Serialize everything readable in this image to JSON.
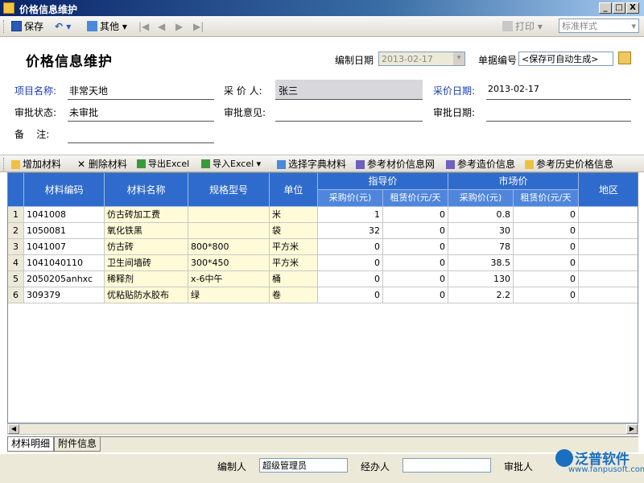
{
  "window": {
    "title": "价格信息维护",
    "controls": [
      "_",
      "□",
      "X"
    ]
  },
  "toolbar": {
    "save_label": "保存",
    "undo_label": "↶",
    "other_label": "其他",
    "nav": [
      "|◀",
      "◀",
      "▶",
      "▶|"
    ],
    "print_label": "打印",
    "style_value": "标准样式"
  },
  "header": {
    "page_title": "价格信息维护",
    "compile_date_label": "编制日期",
    "compile_date_value": "2013-02-17",
    "doc_no_label": "单据编号",
    "doc_no_value": "<保存可自动生成>",
    "project_label": "项目名称:",
    "project_value": "非常天地",
    "buyer_label": "采 价 人:",
    "buyer_value": "张三",
    "price_date_label": "采价日期:",
    "price_date_value": "2013-02-17",
    "approval_status_label": "审批状态:",
    "approval_status_value": "未审批",
    "approval_opinion_label": "审批意见:",
    "approval_date_label": "审批日期:",
    "remark_label": "备    注:"
  },
  "material_toolbar": {
    "add": "增加材料",
    "delete": "删除材料",
    "export": "导出Excel",
    "import": "导入Excel",
    "select_dict": "选择字典材料",
    "ref_material_net": "参考材价信息网",
    "ref_cost": "参考造价信息",
    "ref_history": "参考历史价格信息"
  },
  "grid": {
    "columns": [
      "材料编码",
      "材料名称",
      "规格型号",
      "单位"
    ],
    "group_guide": "指导价",
    "group_market": "市场价",
    "sub_purchase": "采购价(元)",
    "sub_rent": "租赁价(元/天",
    "region": "地区",
    "rows": [
      {
        "no": "1",
        "code": "1041008",
        "name": "仿古砖加工费",
        "spec": "",
        "unit": "米",
        "g_buy": "1",
        "g_rent": "0",
        "m_buy": "0.8",
        "m_rent": "0"
      },
      {
        "no": "2",
        "code": "1050081",
        "name": "氧化铁黑",
        "spec": "",
        "unit": "袋",
        "g_buy": "32",
        "g_rent": "0",
        "m_buy": "30",
        "m_rent": "0"
      },
      {
        "no": "3",
        "code": "1041007",
        "name": "仿古砖",
        "spec": "800*800",
        "unit": "平方米",
        "g_buy": "0",
        "g_rent": "0",
        "m_buy": "78",
        "m_rent": "0"
      },
      {
        "no": "4",
        "code": "1041040110",
        "name": "卫生间墙砖",
        "spec": "300*450",
        "unit": "平方米",
        "g_buy": "0",
        "g_rent": "0",
        "m_buy": "38.5",
        "m_rent": "0"
      },
      {
        "no": "5",
        "code": "2050205anhxc",
        "name": "稀释剂",
        "spec": "x-6中午",
        "unit": "桶",
        "g_buy": "0",
        "g_rent": "0",
        "m_buy": "130",
        "m_rent": "0"
      },
      {
        "no": "6",
        "code": "309379",
        "name": "优粘贴防水胶布",
        "spec": "绿",
        "unit": "卷",
        "g_buy": "0",
        "g_rent": "0",
        "m_buy": "2.2",
        "m_rent": "0"
      }
    ]
  },
  "tabs": [
    "材料明细",
    "附件信息"
  ],
  "footer": {
    "creator_label": "编制人",
    "creator_value": "超级管理员",
    "handler_label": "经办人",
    "handler_value": "",
    "approver_label": "审批人"
  },
  "watermark": {
    "brand": "泛普软件",
    "url": "www.fanpusoft.com"
  },
  "colors": {
    "header_blue": "#2f6bcc",
    "label_blue": "#1a3cb4",
    "row_yellow": "#fffbd8"
  }
}
